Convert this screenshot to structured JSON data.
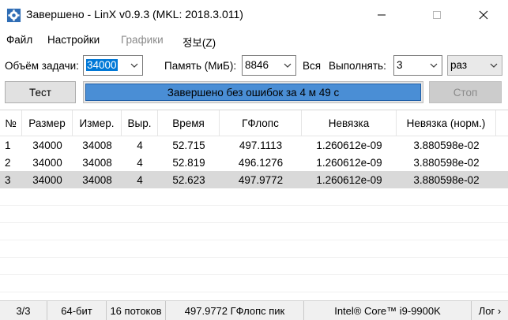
{
  "window": {
    "title": "Завершено - LinX v0.9.3 (MKL: 2018.3.011)"
  },
  "menu": {
    "items": [
      "Файл",
      "Настройки",
      "Графики",
      "정보(Z)"
    ]
  },
  "params": {
    "task_label": "Объём задачи:",
    "task_value": "34000",
    "memory_label": "Память (МиБ):",
    "memory_value": "8846",
    "all_label": "Вся",
    "run_label": "Выполнять:",
    "run_value": "3",
    "unit_value": "раз"
  },
  "controls": {
    "test_button": "Тест",
    "stop_button": "Стоп",
    "progress_text": "Завершено без ошибок за 4 м 49 с",
    "progress_percent": 100
  },
  "table": {
    "headers": [
      "№",
      "Размер",
      "Измер.",
      "Выр.",
      "Время",
      "ГФлопс",
      "Невязка",
      "Невязка (норм.)"
    ],
    "rows": [
      [
        "1",
        "34000",
        "34008",
        "4",
        "52.715",
        "497.1113",
        "1.260612e-09",
        "3.880598e-02"
      ],
      [
        "2",
        "34000",
        "34008",
        "4",
        "52.819",
        "496.1276",
        "1.260612e-09",
        "3.880598e-02"
      ],
      [
        "3",
        "34000",
        "34008",
        "4",
        "52.623",
        "497.9772",
        "1.260612e-09",
        "3.880598e-02"
      ]
    ],
    "selected_row": 3
  },
  "status": {
    "progress": "3/3",
    "bits": "64-бит",
    "threads": "16 потоков",
    "peak": "497.9772 ГФлопс пик",
    "cpu": "Intel® Core™ i9-9900K",
    "log": "Лог ›"
  }
}
